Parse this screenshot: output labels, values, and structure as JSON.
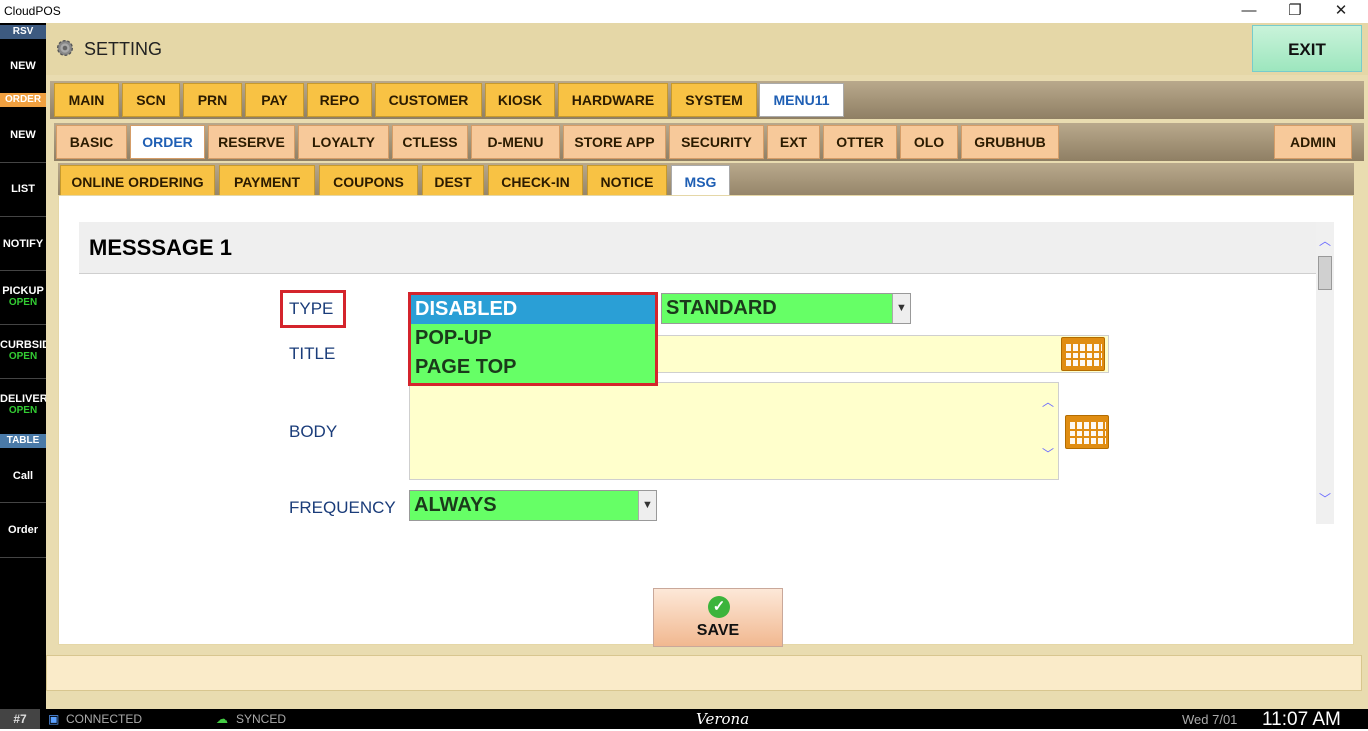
{
  "window": {
    "title": "CloudPOS",
    "minimize": "—",
    "restore": "❐",
    "close": "✕"
  },
  "leftbar": {
    "rsv_label": "RSV",
    "rsv_new": "NEW",
    "order_label": "ORDER",
    "order_new": "NEW",
    "list": "LIST",
    "notify": "NOTIFY",
    "pickup": "PICKUP",
    "pickup_status": "OPEN",
    "curbside": "CURBSID",
    "curbside_status": "OPEN",
    "delivery": "DELIVERY",
    "delivery_status": "OPEN",
    "table_label": "TABLE",
    "call": "Call",
    "order": "Order"
  },
  "header": {
    "title": "SETTING",
    "exit": "EXIT"
  },
  "tabs_main": [
    "MAIN",
    "SCN",
    "PRN",
    "PAY",
    "REPO",
    "CUSTOMER",
    "KIOSK",
    "HARDWARE",
    "SYSTEM",
    "MENU11"
  ],
  "tabs_sub": [
    "BASIC",
    "ORDER",
    "RESERVE",
    "LOYALTY",
    "CTLESS",
    "D-MENU",
    "STORE APP",
    "SECURITY",
    "EXT",
    "OTTER",
    "OLO",
    "GRUBHUB",
    "ADMIN"
  ],
  "tabs_third": [
    "ONLINE ORDERING",
    "PAYMENT",
    "COUPONS",
    "DEST",
    "CHECK-IN",
    "NOTICE",
    "MSG"
  ],
  "form": {
    "section_title": "MESSSAGE 1",
    "type_label": "TYPE",
    "title_label": "TITLE",
    "body_label": "BODY",
    "frequency_label": "FREQUENCY",
    "type_options": [
      "DISABLED",
      "POP-UP",
      "PAGE TOP"
    ],
    "type_selected": "DISABLED",
    "style_value": "STANDARD",
    "frequency_value": "ALWAYS",
    "title_value": "",
    "body_value": "",
    "save_label": "SAVE"
  },
  "status": {
    "station": "#7",
    "connection": "CONNECTED",
    "sync": "SYNCED",
    "store": "Verona",
    "date": "Wed 7/01",
    "time": "11:07 AM"
  },
  "colors": {
    "select_bg": "#66ff66",
    "highlight": "#d4242c",
    "tab_gold": "#f8c244",
    "tab_peach": "#f7c99a"
  }
}
